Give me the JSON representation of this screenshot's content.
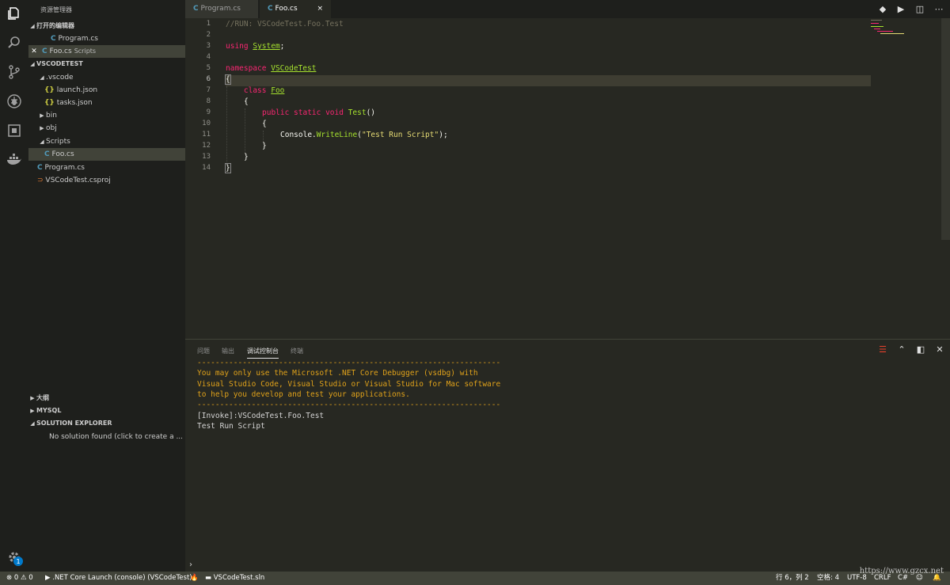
{
  "activity": {
    "icons": [
      "explorer-icon",
      "search-icon",
      "source-control-icon",
      "debug-icon",
      "extensions-icon",
      "docker-icon",
      "settings-icon"
    ],
    "settings_badge": "1"
  },
  "sidebar": {
    "title": "资源管理器",
    "open_editors": {
      "label": "打开的编辑器",
      "items": [
        {
          "name": "Program.cs",
          "desc": ""
        },
        {
          "name": "Foo.cs",
          "desc": "Scripts"
        }
      ]
    },
    "project": {
      "label": "VSCODETEST",
      "tree": [
        {
          "name": ".vscode",
          "type": "folder",
          "expanded": true
        },
        {
          "name": "launch.json",
          "type": "json"
        },
        {
          "name": "tasks.json",
          "type": "json"
        },
        {
          "name": "bin",
          "type": "folder",
          "expanded": false
        },
        {
          "name": "obj",
          "type": "folder",
          "expanded": false
        },
        {
          "name": "Scripts",
          "type": "folder",
          "expanded": true
        },
        {
          "name": "Foo.cs",
          "type": "cs"
        },
        {
          "name": "Program.cs",
          "type": "cs"
        },
        {
          "name": "VSCodeTest.csproj",
          "type": "proj"
        }
      ]
    },
    "outline_label": "大纲",
    "mysql_label": "MYSQL",
    "solution_label": "SOLUTION EXPLORER",
    "solution_message": "No solution found (click to create a ..."
  },
  "tabs": [
    {
      "label": "Program.cs",
      "active": false
    },
    {
      "label": "Foo.cs",
      "active": true
    }
  ],
  "tab_close": "×",
  "editor": {
    "lines": [
      "1",
      "2",
      "3",
      "4",
      "5",
      "6",
      "7",
      "8",
      "9",
      "10",
      "11",
      "12",
      "13",
      "14"
    ],
    "code": {
      "l1": "//RUN: VSCodeTest.Foo.Test",
      "l3_kw": "using",
      "l3_ty": "System",
      "l3_end": ";",
      "l5_kw": "namespace",
      "l5_ty": "VSCodeTest",
      "l6": "{",
      "l7_kw": "class",
      "l7_ty": "Foo",
      "l8": "{",
      "l9_kw": "public static void",
      "l9_fn": "Test",
      "l9_end": "()",
      "l10": "{",
      "l11_a": "Console.",
      "l11_fn": "WriteLine",
      "l11_b": "(",
      "l11_str": "\"Test Run Script\"",
      "l11_c": ");",
      "l12": "}",
      "l13": "}",
      "l14": "}"
    }
  },
  "panel": {
    "tabs": [
      "问题",
      "输出",
      "调试控制台",
      "终端"
    ],
    "active_tab": "调试控制台",
    "output": {
      "dash": "-------------------------------------------------------------------",
      "w1": "You may only use the Microsoft .NET Core Debugger (vsdbg) with",
      "w2": "Visual Studio Code, Visual Studio or Visual Studio for Mac software",
      "w3": "to help you develop and test your applications.",
      "invoke": "[Invoke]:VSCodeTest.Foo.Test",
      "result": "Test Run Script"
    },
    "prompt": "›"
  },
  "status": {
    "errors": "0",
    "warnings": "0",
    "launch": ".NET Core Launch (console) (VSCodeTest)",
    "solution": "VSCodeTest.sln",
    "position": "行 6，列 2",
    "spaces": "空格: 4",
    "encoding": "UTF-8",
    "eol": "CRLF",
    "language": "C#",
    "watermark": "https://www.gzcx.net"
  }
}
